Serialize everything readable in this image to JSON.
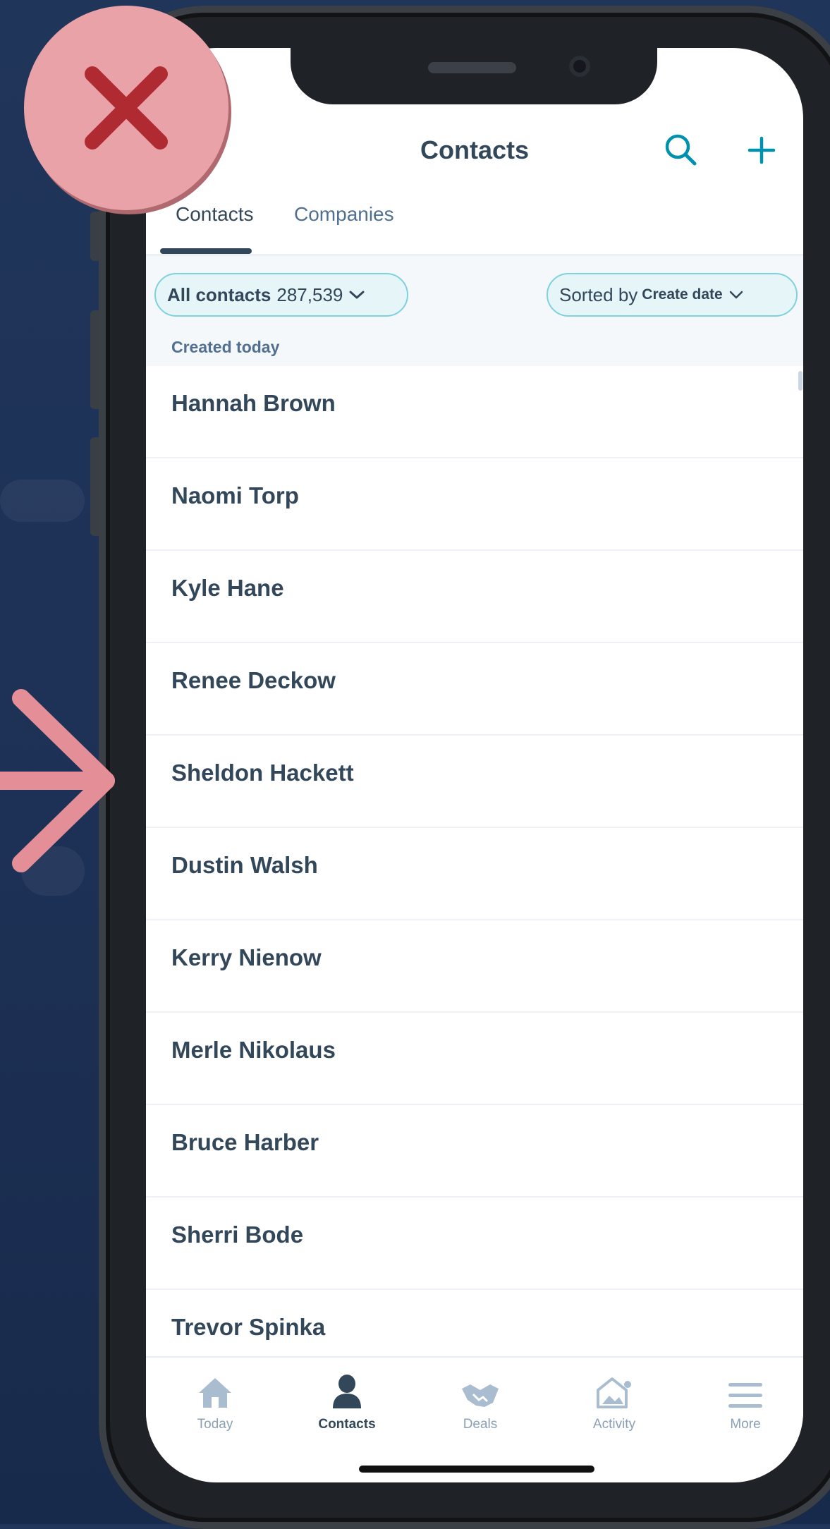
{
  "header": {
    "title": "Contacts"
  },
  "tabs": [
    {
      "label": "Contacts",
      "active": true
    },
    {
      "label": "Companies",
      "active": false
    }
  ],
  "filters": {
    "view_label": "All contacts",
    "view_count": "287,539",
    "sort_prefix": "Sorted by",
    "sort_value": "Create date"
  },
  "section": {
    "title": "Created today"
  },
  "contacts": [
    "Hannah Brown",
    "Naomi Torp",
    "Kyle Hane",
    "Renee Deckow",
    "Sheldon Hackett",
    "Dustin Walsh",
    "Kerry Nienow",
    "Merle Nikolaus",
    "Bruce Harber",
    "Sherri Bode",
    "Trevor Spinka"
  ],
  "tab_bar": [
    {
      "label": "Today",
      "icon": "home-icon"
    },
    {
      "label": "Contacts",
      "icon": "person-icon",
      "active": true
    },
    {
      "label": "Deals",
      "icon": "handshake-icon"
    },
    {
      "label": "Activity",
      "icon": "activity-icon"
    },
    {
      "label": "More",
      "icon": "menu-icon"
    }
  ],
  "colors": {
    "accent": "#0091ae",
    "text": "#33475b",
    "pill_border": "#7fd1de",
    "badge": "#e8a2a8"
  }
}
